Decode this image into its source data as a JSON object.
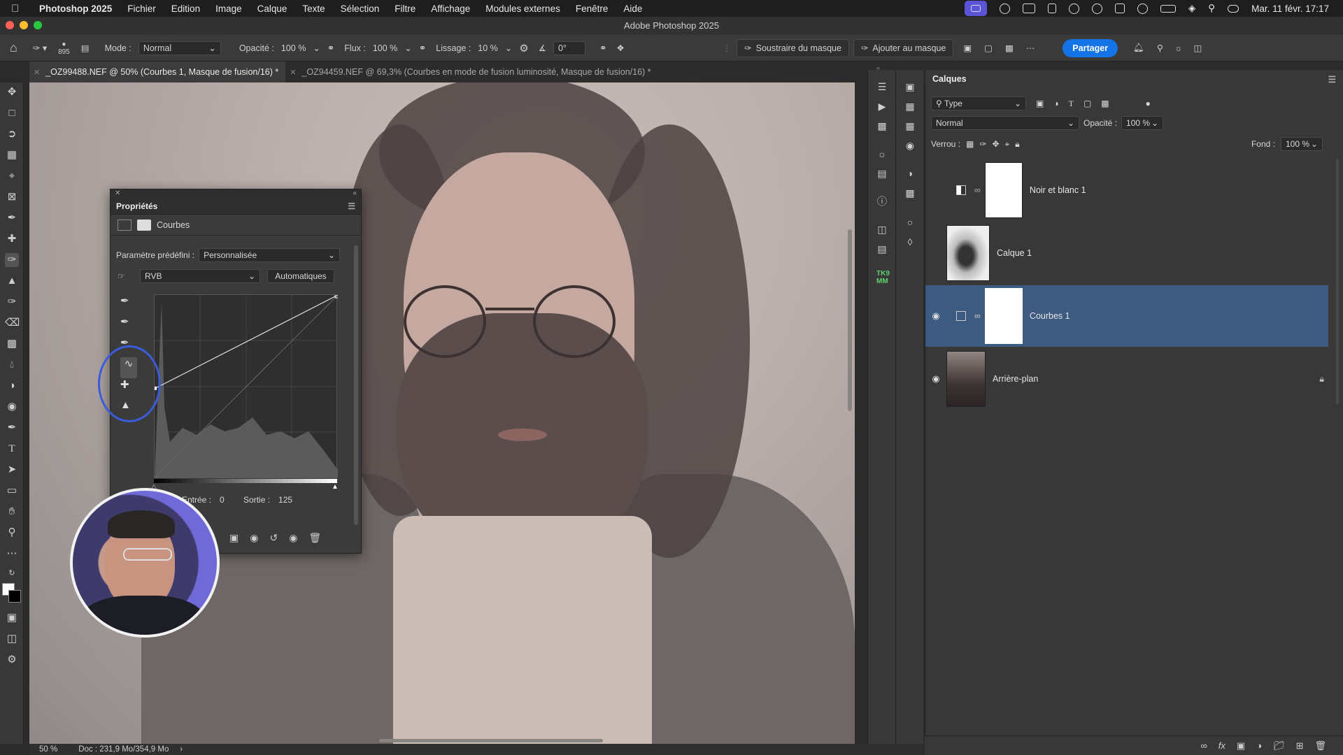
{
  "menubar": {
    "app_name": "Photoshop 2025",
    "items": [
      "Fichier",
      "Edition",
      "Image",
      "Calque",
      "Texte",
      "Sélection",
      "Filtre",
      "Affichage",
      "Modules externes",
      "Fenêtre",
      "Aide"
    ],
    "clock": "Mar. 11 févr. 17:17"
  },
  "window": {
    "title": "Adobe Photoshop 2025"
  },
  "options": {
    "brush_size": "895",
    "mode_label": "Mode :",
    "mode_value": "Normal",
    "opacity_label": "Opacité :",
    "opacity_value": "100 %",
    "flow_label": "Flux :",
    "flow_value": "100 %",
    "smoothing_label": "Lissage :",
    "smoothing_value": "10 %",
    "angle_value": "0°",
    "subtract_mask": "Soustraire du masque",
    "add_mask": "Ajouter au masque",
    "share": "Partager"
  },
  "tabs": [
    {
      "label": "_OZ99488.NEF @ 50% (Courbes 1, Masque de fusion/16) *"
    },
    {
      "label": "_OZ94459.NEF @ 69,3% (Courbes en mode de fusion luminosité, Masque de fusion/16) *"
    }
  ],
  "properties": {
    "title": "Propriétés",
    "type": "Courbes",
    "preset_label": "Paramètre prédéfini :",
    "preset_value": "Personnalisée",
    "channel": "RVB",
    "auto_button": "Automatiques",
    "input_label": "Entrée :",
    "input_value": "0",
    "output_label": "Sortie :",
    "output_value": "125"
  },
  "layers": {
    "title": "Calques",
    "filter_type": "Type",
    "blend_mode": "Normal",
    "opacity_label": "Opacité :",
    "opacity_value": "100 %",
    "lock_label": "Verrou :",
    "fill_label": "Fond :",
    "fill_value": "100 %",
    "items": [
      {
        "name": "Noir et blanc 1",
        "visible": false,
        "selected": false
      },
      {
        "name": "Calque 1",
        "visible": false,
        "selected": false
      },
      {
        "name": "Courbes 1",
        "visible": true,
        "selected": true
      },
      {
        "name": "Arrière-plan",
        "visible": true,
        "selected": false
      }
    ]
  },
  "status": {
    "zoom": "50 %",
    "doc": "Doc : 231,9 Mo/354,9 Mo"
  },
  "colors": {
    "accent": "#1473e6",
    "selected_layer": "#3d5a80",
    "highlight_circle": "#3b5bdb"
  }
}
